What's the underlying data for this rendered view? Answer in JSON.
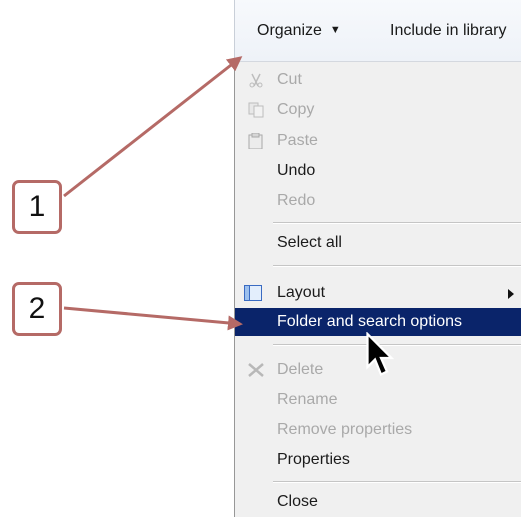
{
  "toolbar": {
    "organize_label": "Organize",
    "include_label": "Include in library"
  },
  "menu": {
    "cut": "Cut",
    "copy": "Copy",
    "paste": "Paste",
    "undo": "Undo",
    "redo": "Redo",
    "select_all": "Select all",
    "layout": "Layout",
    "folder_options": "Folder and search options",
    "delete": "Delete",
    "rename": "Rename",
    "remove_properties": "Remove properties",
    "properties": "Properties",
    "close": "Close"
  },
  "callouts": {
    "one": "1",
    "two": "2"
  },
  "colors": {
    "selection": "#0a246a",
    "callout_border": "#b56a66",
    "disabled_text": "#a9a9a9"
  },
  "icons": [
    "caret-down-icon",
    "scissors-icon",
    "copy-icon",
    "paste-icon",
    "layout-icon",
    "submenu-arrow-icon",
    "delete-x-icon",
    "mouse-cursor-icon"
  ]
}
